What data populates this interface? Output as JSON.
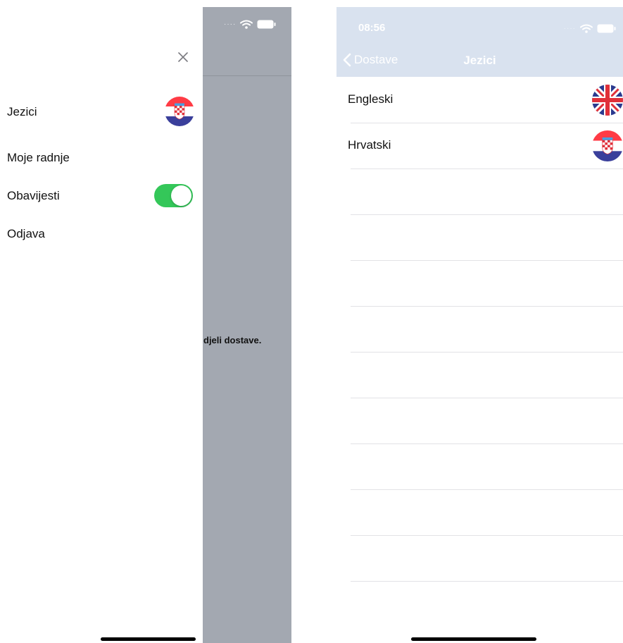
{
  "left": {
    "menu": {
      "languages": "Jezici",
      "my_actions": "Moje radnje",
      "notifications": "Obavijesti",
      "logout": "Odjava"
    },
    "notifications_enabled": true,
    "selected_language_flag": "croatia-flag-icon",
    "dimmed_message": "djeli dostave."
  },
  "right": {
    "status_time": "08:56",
    "nav": {
      "back_label": "Dostave",
      "title": "Jezici"
    },
    "languages": [
      {
        "label": "Engleski",
        "flag": "uk-flag-icon"
      },
      {
        "label": "Hrvatski",
        "flag": "croatia-flag-icon"
      }
    ]
  },
  "colors": {
    "toggle_on": "#34c759",
    "overlay": "#a3a8b1",
    "navbar": "#d9e2ef"
  }
}
